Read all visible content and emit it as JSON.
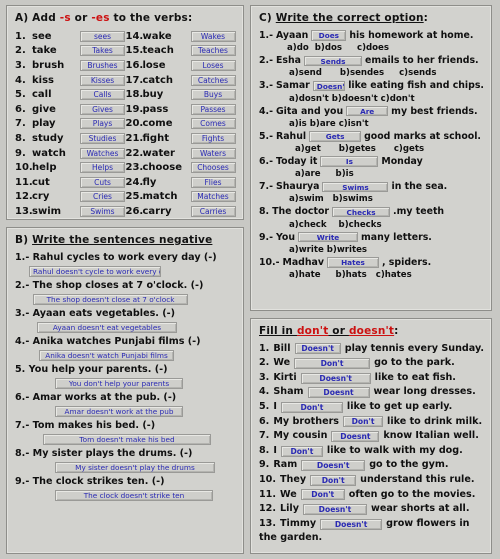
{
  "sections": {
    "a": {
      "heading_prefix": "A)  Add ",
      "heading_red1": "-s",
      "heading_mid": " or ",
      "heading_red2": "-es",
      "heading_suffix": " to the verbs:",
      "items": [
        {
          "num": "1.",
          "verb": "see",
          "answer": "sees"
        },
        {
          "num": "2.",
          "verb": "take",
          "answer": "Takes"
        },
        {
          "num": "3.",
          "verb": "brush",
          "answer": "Brushes"
        },
        {
          "num": "4.",
          "verb": "kiss",
          "answer": "Kisses"
        },
        {
          "num": "5.",
          "verb": "call",
          "answer": "Calls"
        },
        {
          "num": "6.",
          "verb": "give",
          "answer": "Gives"
        },
        {
          "num": "7.",
          "verb": "play",
          "answer": "Plays"
        },
        {
          "num": "8.",
          "verb": "study",
          "answer": "Studies"
        },
        {
          "num": "9.",
          "verb": "watch",
          "answer": "Watches"
        },
        {
          "num": "10.",
          "verb": "help",
          "answer": "Helps"
        },
        {
          "num": "11.",
          "verb": "cut",
          "answer": "Cuts"
        },
        {
          "num": "12.",
          "verb": "cry",
          "answer": "Cries"
        },
        {
          "num": "13.",
          "verb": "swim",
          "answer": "Swims"
        },
        {
          "num": "14.",
          "verb": "wake",
          "answer": "Wakes"
        },
        {
          "num": "15.",
          "verb": "teach",
          "answer": "Teaches"
        },
        {
          "num": "16.",
          "verb": "lose",
          "answer": "Loses"
        },
        {
          "num": "17.",
          "verb": "catch",
          "answer": "Catches"
        },
        {
          "num": "18.",
          "verb": "buy",
          "answer": "Buys"
        },
        {
          "num": "19.",
          "verb": "pass",
          "answer": "Passes"
        },
        {
          "num": "20.",
          "verb": "come",
          "answer": "Comes"
        },
        {
          "num": "21.",
          "verb": "fight",
          "answer": "Fights"
        },
        {
          "num": "22.",
          "verb": "water",
          "answer": "Waters"
        },
        {
          "num": "23.",
          "verb": "choose",
          "answer": "Chooses"
        },
        {
          "num": "24.",
          "verb": "fly",
          "answer": "Flies"
        },
        {
          "num": "25.",
          "verb": "match",
          "answer": "Matches"
        },
        {
          "num": "26.",
          "verb": "carry",
          "answer": "Carries"
        }
      ]
    },
    "b": {
      "heading_prefix": "B) ",
      "heading_underlined": "Write the sentences negative",
      "items": [
        {
          "num": "1.-",
          "question": "Rahul cycles to work every day (-)",
          "answer": "Rahul doesn't cycle to work every day",
          "width": 132,
          "indent": 14
        },
        {
          "num": "2.-",
          "question": "The shop closes at 7 o'clock. (-)",
          "answer": "The shop doesn't close at 7 o'clock",
          "width": 155,
          "indent": 18
        },
        {
          "num": "3.-",
          "question": "Ayaan eats vegetables. (-)",
          "answer": "Ayaan doesn't eat vegetables",
          "width": 140,
          "indent": 22
        },
        {
          "num": "4.-",
          "question": "Anika watches Punjabi films (-)",
          "answer": "Anika doesn't watch Punjabi films",
          "width": 135,
          "indent": 24
        },
        {
          "num": "5.",
          "question": "You help your parents. (-)",
          "answer": "You don't help your parents",
          "width": 128,
          "indent": 40
        },
        {
          "num": "6.-",
          "question": "Amar works at the pub. (-)",
          "answer": "Amar doesn't work at the pub",
          "width": 128,
          "indent": 40
        },
        {
          "num": "7.-",
          "question": "Tom makes his bed. (-)",
          "answer": "Tom doesn't make his bed",
          "width": 168,
          "indent": 28
        },
        {
          "num": "8.-",
          "question": "My sister plays the drums. (-)",
          "answer": "My sister doesn't play the drums",
          "width": 160,
          "indent": 40
        },
        {
          "num": "9.-",
          "question": "The clock strikes ten. (-)",
          "answer": "The clock doesn't strike ten",
          "width": 158,
          "indent": 40
        }
      ]
    },
    "c": {
      "heading_prefix": "C) ",
      "heading_underlined": "Write the correct option",
      "heading_colon": ":",
      "items": [
        {
          "num": "1.-",
          "before": "Ayaan",
          "answer": "Does",
          "after": "his homework at home.",
          "width": 35,
          "choices": "a)do  b)dos     c)does",
          "choices_indent": 28
        },
        {
          "num": "2.-",
          "before": "Esha",
          "answer": "Sends",
          "after": "emails to her friends.",
          "width": 58,
          "choices": "a)send      b)sendes     c)sends",
          "choices_indent": 30
        },
        {
          "num": "3.-",
          "before": "Samar",
          "answer": "Doesn't",
          "after": "like eating fish and chips.",
          "width": 42,
          "choices": "a)dosn't b)doesn't c)don't",
          "choices_indent": 30
        },
        {
          "num": "4.-",
          "before": "Gita and you",
          "answer": "Are",
          "after": "my best friends.",
          "width": 42,
          "choices": "a)is b)are c)isn't",
          "choices_indent": 30
        },
        {
          "num": "5.-",
          "before": "Rahul",
          "answer": "Gets",
          "after": "good marks at school.",
          "width": 52,
          "choices": "a)get      b)getes      c)gets",
          "choices_indent": 36
        },
        {
          "num": "6.-",
          "before": "Today it",
          "answer": "Is",
          "after": "Monday",
          "width": 58,
          "choices": "a)are     b)is",
          "choices_indent": 36
        },
        {
          "num": "7.-",
          "before": "Shaurya",
          "answer": "Swims",
          "after": "in the sea.",
          "width": 66,
          "choices": "a)swim   b)swims",
          "choices_indent": 30
        },
        {
          "num": "8.",
          "before": "The doctor",
          "answer": "Checks",
          "after": ".my teeth",
          "width": 58,
          "choices": "a)check    b)checks",
          "choices_indent": 30
        },
        {
          "num": "9.-",
          "before": "You",
          "answer": "Write",
          "after": "many letters.",
          "width": 60,
          "choices": "a)write b)writes",
          "choices_indent": 30
        },
        {
          "num": "10.-",
          "before": "Madhav",
          "answer": "Hates",
          "after": ", spiders.",
          "width": 52,
          "choices": "a)hate     b)hats   c)hates",
          "choices_indent": 30
        }
      ]
    },
    "d": {
      "heading_prefix": "Fill in ",
      "heading_red1": "don't",
      "heading_mid": " or ",
      "heading_red2": "doesn't",
      "heading_suffix": ":",
      "items": [
        {
          "num": "1.",
          "subject": "Bill",
          "answer": "Doesn't",
          "after": "play tennis every Sunday.",
          "width": 54
        },
        {
          "num": "2.",
          "subject": "We",
          "answer": "Don't",
          "after": "go to the park.",
          "width": 76
        },
        {
          "num": "3.",
          "subject": "Kirti",
          "answer": "Doesn't",
          "after": "like to eat fish.",
          "width": 70
        },
        {
          "num": "4.",
          "subject": "Sham",
          "answer": "Doesnt",
          "after": "wear long dresses.",
          "width": 62
        },
        {
          "num": "5.",
          "subject": "I",
          "answer": "Don't",
          "after": "like to get up early.",
          "width": 62
        },
        {
          "num": "6.",
          "subject": "My brothers",
          "answer": "Don't",
          "after": "like to drink milk.",
          "width": 40
        },
        {
          "num": "7.",
          "subject": "My cousin",
          "answer": "Doesnt",
          "after": "know Italian well.",
          "width": 48
        },
        {
          "num": "8.",
          "subject": "I",
          "answer": "Don't",
          "after": "like to walk with my dog.",
          "width": 42
        },
        {
          "num": "9.",
          "subject": "Ram",
          "answer": "Doesn't",
          "after": "go to the gym.",
          "width": 64
        },
        {
          "num": "10.",
          "subject": "They",
          "answer": "Don't",
          "after": "understand this rule.",
          "width": 46
        },
        {
          "num": "11.",
          "subject": "We",
          "answer": "Don't",
          "after": "often go to the movies.",
          "width": 44
        },
        {
          "num": "12.",
          "subject": "Lily",
          "answer": "Doesn't",
          "after": "wear shorts at all.",
          "width": 64
        },
        {
          "num": "13.",
          "subject": "Timmy",
          "answer": "Doesn't",
          "after": "grow flowers in",
          "width": 62
        }
      ],
      "tail": "the garden."
    }
  }
}
